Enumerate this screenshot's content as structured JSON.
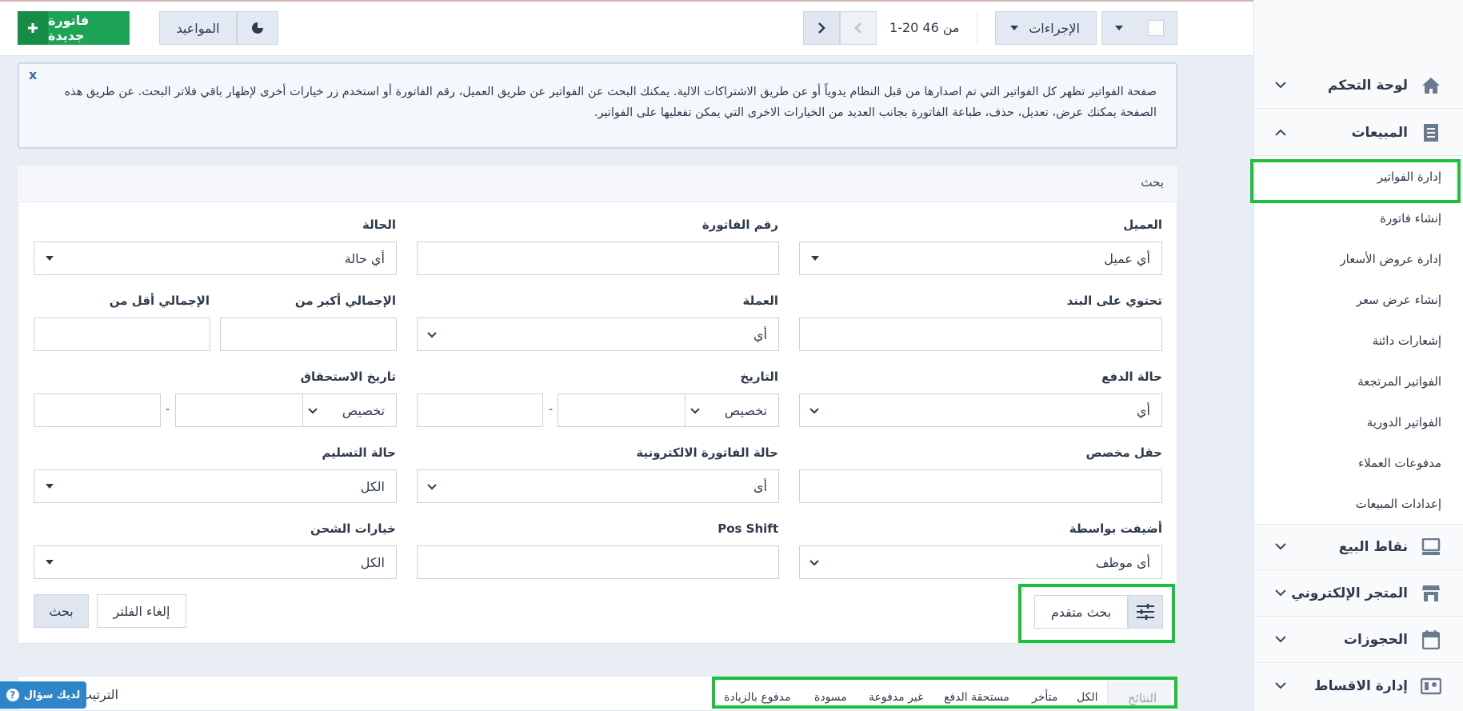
{
  "header": {
    "new_invoice": "فاتورة جديدة",
    "appointments": "المواعيد",
    "pagination": "1-20  من 46",
    "actions": "الإجراءات"
  },
  "info_text": "صفحة الفواتير تظهر كل الفواتير التي تم اصدارها من قبل النظام يدوياً أو عن طريق الاشتراكات الالية. يمكنك البحث عن الفواتير عن طريق العميل، رقم الفاتورة أو استخدم زر خيارات أخرى لإظهار باقي فلاتر البحث. عن طريق هذه الصفحة يمكنك عرض، تعديل، حذف، طباعة الفاتورة بجانب العديد من الخيارات الاخرى التي يمكن تفعليها على الفواتير.",
  "info_close": "x",
  "search": {
    "title": "بحث",
    "client_label": "العميل",
    "client_value": "أي عميل",
    "invoice_no_label": "رقم الفاتورة",
    "status_label": "الحالة",
    "status_value": "أي حالة",
    "item_label": "تحتوي على البند",
    "currency_label": "العملة",
    "currency_value": "أي",
    "total_gt_label": "الإجمالي أكبر من",
    "total_lt_label": "الإجمالي أقل من",
    "payment_status_label": "حالة الدفع",
    "payment_status_value": "أي",
    "date_label": "التاريخ",
    "date_value": "تخصيص",
    "due_date_label": "تاريخ الاستحقاق",
    "due_date_value": "تخصيص",
    "custom_field_label": "حقل مخصص",
    "einvoice_label": "حالة الفاتورة الالكترونية",
    "einvoice_value": "أى",
    "delivery_label": "حالة التسليم",
    "delivery_value": "الكل",
    "added_by_label": "أضيفت بواسطة",
    "added_by_value": "أى موظف",
    "pos_shift_label": "Pos Shift",
    "shipping_label": "خيارات الشحن",
    "shipping_value": "الكل",
    "dash": "-",
    "advanced": "بحث متقدم",
    "cancel_filter": "إلغاء الفلتر",
    "search_btn": "بحث"
  },
  "results": {
    "label": "النتائج",
    "tabs": [
      "الكل",
      "متأخر",
      "مستحقة الدفع",
      "غير مدفوعة",
      "مسودة",
      "مدفوع بالزيادة"
    ],
    "sort": "الترتيب"
  },
  "help": "لديك سؤال",
  "sidebar": {
    "dashboard": "لوحة التحكم",
    "sales": "المبيعات",
    "sub": [
      "إدارة الفواتير",
      "إنشاء فاتورة",
      "إدارة عروض الأسعار",
      "إنشاء عرض سعر",
      "إشعارات دائنة",
      "الفواتير المرتجعة",
      "الفواتير الدورية",
      "مدفوعات العملاء",
      "إعدادات المبيعات"
    ],
    "pos": "نقاط البيع",
    "store": "المتجر الإلكتروني",
    "bookings": "الحجوزات",
    "installments": "إدارة الاقساط"
  },
  "colors": {
    "green": "#1da355",
    "highlight": "#19c23a"
  }
}
